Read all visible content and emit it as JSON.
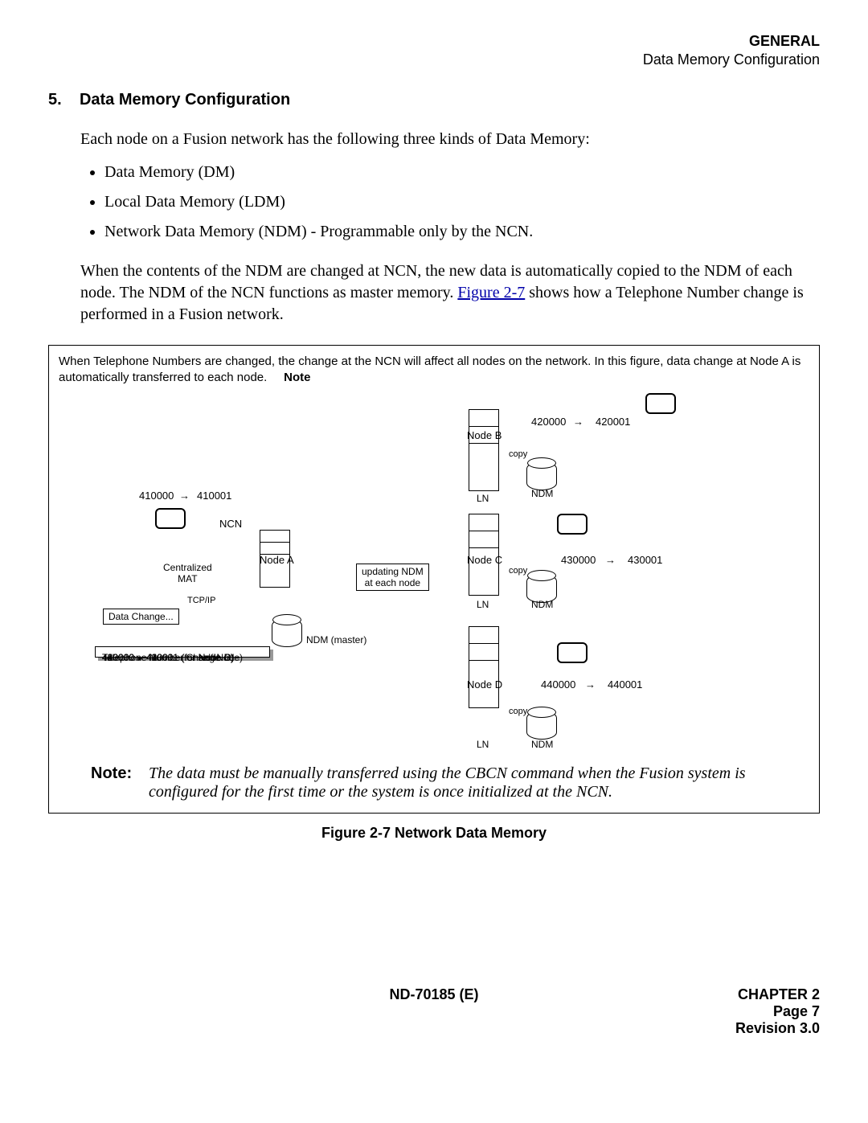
{
  "header": {
    "general": "GENERAL",
    "subtitle": "Data Memory Configuration"
  },
  "section": {
    "number": "5.",
    "title": "Data Memory Configuration"
  },
  "intro": "Each node on a Fusion network has the following three kinds of Data Memory:",
  "memory_types": [
    "Data Memory (DM)",
    "Local Data Memory (LDM)",
    "Network Data Memory (NDM)  -  Programmable only by the NCN."
  ],
  "para2_a": "When the contents of the NDM are changed at NCN, the new data is automatically copied to the NDM of each node. The NDM of the NCN functions as master memory. ",
  "para2_link": "Figure 2-7",
  "para2_b": " shows how a Telephone Number change is performed in a Fusion network.",
  "figure": {
    "intro_text": "When Telephone Numbers are changed, the change at the NCN will affect all nodes on the network.  In this figure, data change at Node A is automatically transferred to each node.",
    "intro_note": "Note",
    "labels": {
      "ncn": "NCN",
      "node_a": "Node A",
      "node_b": "Node B",
      "node_c": "Node C",
      "node_d": "Node D",
      "ln": "LN",
      "ndm": "NDM",
      "ndm_master": "NDM (master)",
      "centralized_mat": "Centralized\nMAT",
      "tcpip": "TCP/IP",
      "data_change": "Data Change...",
      "updating": "updating NDM\nat each node",
      "copy": "copy"
    },
    "tel_changes": {
      "a_from": "410000",
      "a_to": "410001",
      "b_from": "420000",
      "b_to": "420001",
      "c_from": "430000",
      "c_to": "430001",
      "d_from": "440000",
      "d_to": "440001"
    },
    "changes_box": {
      "title": "Telephone Number Change",
      "rows": [
        {
          "from": "410000",
          "to": "410001",
          "for": "(for self-Node)"
        },
        {
          "from": "420000",
          "to": "420001",
          "for": "(for Node B)"
        },
        {
          "from": "430000",
          "to": "430001",
          "for": "(for Node C)"
        },
        {
          "from": "440000",
          "to": "440001",
          "for": "(for Node D)"
        }
      ]
    },
    "note_label": "Note:",
    "note_text": "The data must be manually transferred using the CBCN command when the Fusion system is configured for the first time or the system is once initialized at the NCN.",
    "caption": "Figure 2-7   Network Data Memory"
  },
  "footer": {
    "doc_id": "ND-70185 (E)",
    "chapter": "CHAPTER 2",
    "page": "Page 7",
    "revision": "Revision 3.0"
  }
}
